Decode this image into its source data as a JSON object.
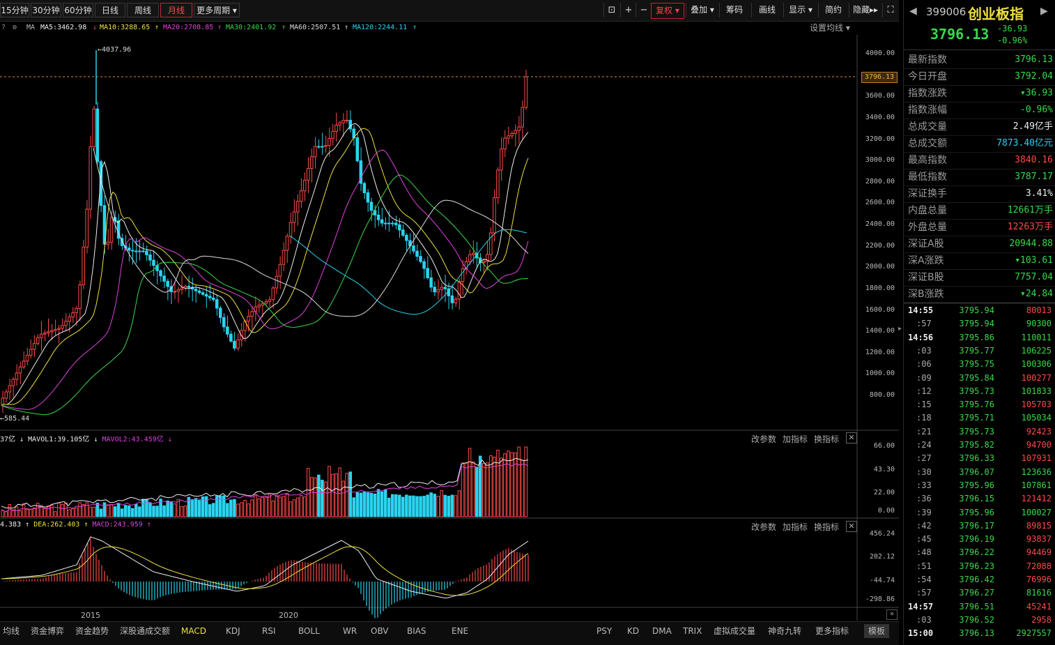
{
  "toolbar": {
    "periods": [
      "15分钟",
      "30分钟",
      "60分钟",
      "日线",
      "周线",
      "月线",
      "更多周期"
    ],
    "active_period": "月线",
    "right_buttons": [
      "复权",
      "叠加",
      "筹码",
      "画线",
      "显示",
      "简约",
      "隐藏"
    ]
  },
  "ma_legend": {
    "ma_label": "MA",
    "ma5": "MA5:3462.98",
    "ma10": "MA10:3288.65",
    "ma20": "MA20:2708.85",
    "ma30": "MA30:2401.92",
    "ma60": "MA60:2507.51",
    "ma120": "MA120:2244.11",
    "settings": "设置均线"
  },
  "main_chart": {
    "price_ticks": [
      "4000.00",
      "3600.00",
      "3400.00",
      "3200.00",
      "3000.00",
      "2800.00",
      "2600.00",
      "2400.00",
      "2200.00",
      "2000.00",
      "1800.00",
      "1600.00",
      "1400.00",
      "1200.00",
      "1000.00",
      "800.00"
    ],
    "current_price_tag": "3796.13",
    "high_marker": "4037.96",
    "low_marker": "585.44"
  },
  "volume_panel": {
    "vol_label": "37亿",
    "mavol1": "MAVOL1:39.105亿",
    "mavol2": "MAVOL2:43.459亿",
    "ticks": [
      "66.00",
      "43.30",
      "22.00",
      "0.00"
    ],
    "links": [
      "改参数",
      "加指标",
      "换指标"
    ]
  },
  "macd_panel": {
    "dif": "4.383",
    "dea": "DEA:262.403",
    "macd": "MACD:243.959",
    "ticks": [
      "456.24",
      "202.12",
      "-44.74",
      "-298.86"
    ],
    "links": [
      "改参数",
      "加指标",
      "换指标"
    ]
  },
  "x_axis": [
    "2015",
    "2020"
  ],
  "bottom_tabs": [
    "均线",
    "资金博弈",
    "资金趋势",
    "深股通成交额",
    "MACD",
    "KDJ",
    "RSI",
    "BOLL",
    "WR",
    "OBV",
    "BIAS",
    "ENE"
  ],
  "bottom_tabs_right": [
    "PSY",
    "KD",
    "DMA",
    "TRIX",
    "虚拟成交量",
    "神奇九转",
    "更多指标",
    "模板"
  ],
  "selected_bottom_tab": "MACD",
  "side": {
    "code": "399006",
    "name": "创业板指",
    "price": "3796.13",
    "change": "-36.93",
    "change_pct": "-0.96%",
    "rows": [
      {
        "k": "最新指数",
        "v": "3796.13",
        "c": "green"
      },
      {
        "k": "今日开盘",
        "v": "3792.04",
        "c": "green"
      },
      {
        "k": "指数涨跌",
        "v": "▾36.93",
        "c": "green"
      },
      {
        "k": "指数涨幅",
        "v": "-0.96%",
        "c": "green"
      },
      {
        "k": "总成交量",
        "v": "2.49亿手",
        "c": "white"
      },
      {
        "k": "总成交额",
        "v": "7873.40亿元",
        "c": "cyan"
      },
      {
        "k": "最高指数",
        "v": "3840.16",
        "c": "red"
      },
      {
        "k": "最低指数",
        "v": "3787.17",
        "c": "green"
      },
      {
        "k": "深证换手",
        "v": "3.41%",
        "c": "white"
      },
      {
        "k": "内盘总量",
        "v": "12661万手",
        "c": "green"
      },
      {
        "k": "外盘总量",
        "v": "12263万手",
        "c": "red"
      },
      {
        "k": "深证A股",
        "v": "20944.88",
        "c": "green"
      },
      {
        "k": "深A涨跌",
        "v": "▾103.61",
        "c": "green"
      },
      {
        "k": "深证B股",
        "v": "7757.04",
        "c": "green"
      },
      {
        "k": "深B涨跌",
        "v": "▾24.84",
        "c": "green"
      }
    ],
    "ticks": [
      {
        "t": "14:55",
        "p": "3795.94",
        "v": "80013",
        "c": "red",
        "bold": true
      },
      {
        "t": ":57",
        "p": "3795.94",
        "v": "90300",
        "c": "green"
      },
      {
        "t": "14:56",
        "p": "3795.86",
        "v": "110011",
        "c": "green",
        "bold": true
      },
      {
        "t": ":03",
        "p": "3795.77",
        "v": "106225",
        "c": "green"
      },
      {
        "t": ":06",
        "p": "3795.75",
        "v": "100306",
        "c": "green"
      },
      {
        "t": ":09",
        "p": "3795.84",
        "v": "100277",
        "c": "red"
      },
      {
        "t": ":12",
        "p": "3795.73",
        "v": "101833",
        "c": "green"
      },
      {
        "t": ":15",
        "p": "3795.76",
        "v": "105703",
        "c": "red"
      },
      {
        "t": ":18",
        "p": "3795.71",
        "v": "105034",
        "c": "green"
      },
      {
        "t": ":21",
        "p": "3795.73",
        "v": "92423",
        "c": "red"
      },
      {
        "t": ":24",
        "p": "3795.82",
        "v": "94700",
        "c": "red"
      },
      {
        "t": ":27",
        "p": "3796.33",
        "v": "107931",
        "c": "red"
      },
      {
        "t": ":30",
        "p": "3796.07",
        "v": "123636",
        "c": "green"
      },
      {
        "t": ":33",
        "p": "3795.96",
        "v": "107861",
        "c": "green"
      },
      {
        "t": ":36",
        "p": "3796.15",
        "v": "121412",
        "c": "red"
      },
      {
        "t": ":39",
        "p": "3795.96",
        "v": "100027",
        "c": "green"
      },
      {
        "t": ":42",
        "p": "3796.17",
        "v": "89815",
        "c": "red"
      },
      {
        "t": ":45",
        "p": "3796.19",
        "v": "93837",
        "c": "red"
      },
      {
        "t": ":48",
        "p": "3796.22",
        "v": "94469",
        "c": "red"
      },
      {
        "t": ":51",
        "p": "3796.23",
        "v": "72088",
        "c": "red"
      },
      {
        "t": ":54",
        "p": "3796.42",
        "v": "76996",
        "c": "red"
      },
      {
        "t": ":57",
        "p": "3796.27",
        "v": "81616",
        "c": "green"
      },
      {
        "t": "14:57",
        "p": "3796.51",
        "v": "45241",
        "c": "red",
        "bold": true
      },
      {
        "t": ":03",
        "p": "3796.52",
        "v": "2958",
        "c": "red"
      },
      {
        "t": "15:00",
        "p": "3796.13",
        "v": "2927557",
        "c": "green",
        "bold": true
      }
    ]
  }
}
